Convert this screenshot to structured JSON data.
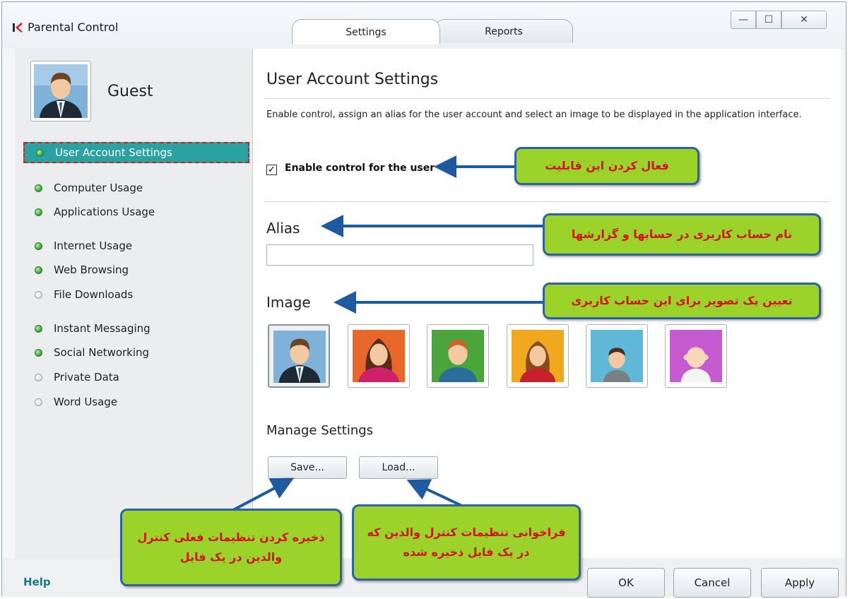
{
  "window": {
    "title": "Parental Control",
    "tabs": [
      {
        "label": "Settings",
        "active": true
      },
      {
        "label": "Reports",
        "active": false
      }
    ],
    "controls": {
      "minimize": "—",
      "maximize": "☐",
      "close": "✕"
    }
  },
  "sidebar": {
    "user_name": "Guest",
    "items": [
      {
        "label": "User Account Settings",
        "status": "on",
        "active": true
      },
      {
        "label": "Computer Usage",
        "status": "on"
      },
      {
        "label": "Applications Usage",
        "status": "on"
      },
      {
        "label": "Internet Usage",
        "status": "on"
      },
      {
        "label": "Web Browsing",
        "status": "on"
      },
      {
        "label": "File Downloads",
        "status": "off"
      },
      {
        "label": "Instant Messaging",
        "status": "on"
      },
      {
        "label": "Social Networking",
        "status": "on"
      },
      {
        "label": "Private Data",
        "status": "off"
      },
      {
        "label": "Word Usage",
        "status": "off"
      }
    ]
  },
  "main": {
    "title": "User Account Settings",
    "description": "Enable control, assign an alias for the user account and select an image to be displayed in the application interface.",
    "enable_checkbox": {
      "label": "Enable control for the user",
      "checked": true,
      "mark": "✓"
    },
    "alias": {
      "heading": "Alias",
      "value": ""
    },
    "image": {
      "heading": "Image",
      "choices": [
        {
          "name": "man-in-suit",
          "bg": "#7fb2d8",
          "selected": true
        },
        {
          "name": "woman-red",
          "bg": "#e8672a"
        },
        {
          "name": "boy-green",
          "bg": "#4aa63a"
        },
        {
          "name": "girl-yellow",
          "bg": "#f0a81e"
        },
        {
          "name": "child-blue",
          "bg": "#5fb8d8"
        },
        {
          "name": "baby-pink",
          "bg": "#c65ad0"
        }
      ]
    },
    "manage": {
      "heading": "Manage Settings",
      "save_label": "Save...",
      "load_label": "Load..."
    }
  },
  "footer": {
    "help": "Help",
    "ok": "OK",
    "cancel": "Cancel",
    "apply": "Apply"
  },
  "annotations": {
    "enable": "فعال کردن این قابلیت",
    "alias": "نام حساب کاربری در حسابها و گزارشها",
    "image": "تعیین یک تصویر برای این حساب کاربری",
    "save": "ذخیره کردن تنظیمات فعلی کنترل والدین در یک فایل",
    "load": "فراخوانی تنظیمات کنترل والدین که در یک فایل ذخیره شده"
  },
  "colors": {
    "accent": "#2aa2a2",
    "note_bg": "#9bd32a",
    "note_border": "#2b63a5",
    "note_text": "#d4111a"
  }
}
